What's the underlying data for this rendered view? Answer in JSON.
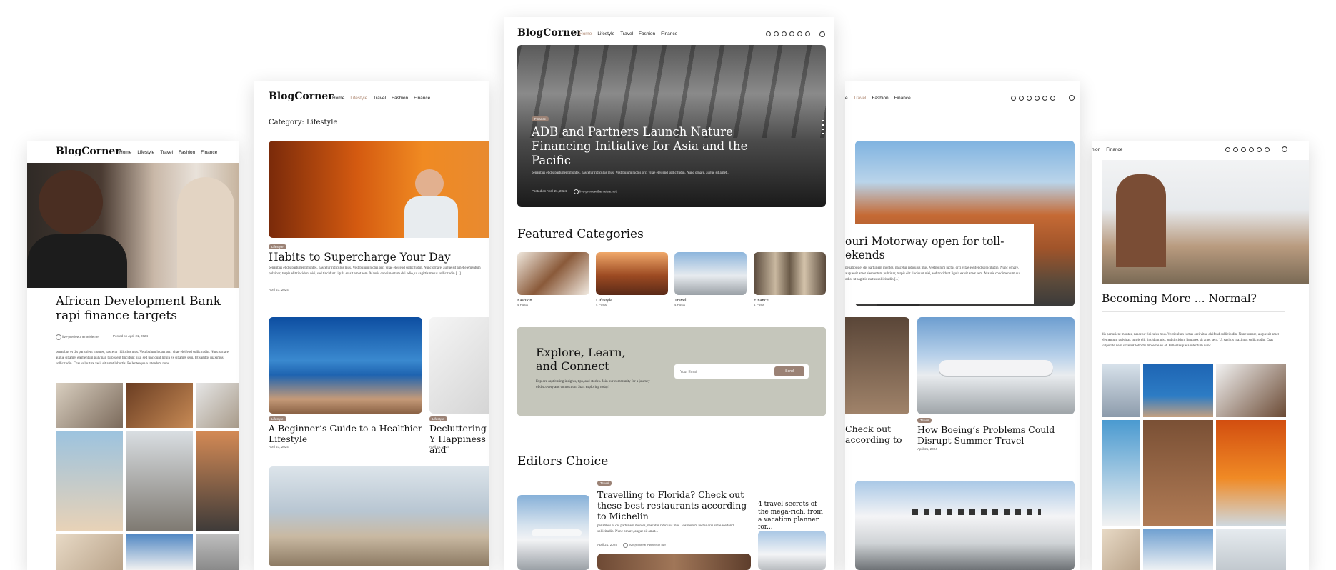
{
  "brand": "BlogCorner",
  "nav": {
    "home": "Home",
    "lifestyle": "Lifestyle",
    "travel": "Travel",
    "fashion": "Fashion",
    "finance": "Finance"
  },
  "social_icons": [
    "facebook-icon",
    "instagram-icon",
    "x-icon",
    "linkedin-icon",
    "tiktok-icon",
    "youtube-icon"
  ],
  "colors": {
    "accent": "#9b8275",
    "newsletter_bg": "#c5c6bb",
    "active_nav": "#b08a74"
  },
  "panel1": {
    "title": "African Development Bank rapi finance targets",
    "author": "live-preview.themeisle.net",
    "date": "Posted on April 21, 2024",
    "excerpt": "penatibus et dis parturient montes, nascetur ridiculus mus. Vestibulum luctus orci vitae eleifend sollicitudin. Nunc ornare, augue sit amet elementum pulvinar, turpis elit tincidunt nisi, sed tincidunt ligula ex sit amet sem. Ut sagittis maximus sollicitudin. Cras vulputate velit sit amet lobortis. Pellentesque a interdum nunc."
  },
  "panel2": {
    "category": "Category: Lifestyle",
    "post1": {
      "tag": "Lifestyle",
      "title": "Habits to Supercharge Your Day",
      "excerpt": "penatibus et dis parturient montes, nascetur ridiculus mus. Vestibulum luctus orci vitae eleifend sollicitudin. Nunc ornare, augue sit amet elementum pulvinar, turpis elit tincidunt nisi, sed tincidunt ligula ex sit amet sem. Mauris condimentum dui odio, ut sagittis metus sollicitudin [...]",
      "date": "April 21, 2024"
    },
    "post2": {
      "tag": "Lifestyle",
      "title": "A Beginner’s Guide to a Healthier Lifestyle",
      "date": "April 21, 2024"
    },
    "post3": {
      "tag": "Lifestyle",
      "title": "Decluttering Y Happiness and",
      "date": "April 21, 2024"
    }
  },
  "panel3": {
    "hero": {
      "tag": "Finance",
      "title": "ADB and Partners Launch Nature Financing Initiative for Asia and the Pacific",
      "excerpt": "penatibus et dis parturient montes, nascetur ridiculus mus. Vestibulum luctus orci vitae eleifend sollicitudin. Nunc ornare, augue sit amet...",
      "date": "Posted on April 21, 2024",
      "author": "live-preview.themeisle.net"
    },
    "featured_heading": "Featured Categories",
    "categories": [
      {
        "name": "Fashion",
        "count": "4 Posts"
      },
      {
        "name": "Lifestyle",
        "count": "4 Posts"
      },
      {
        "name": "Travel",
        "count": "4 Posts"
      },
      {
        "name": "Finance",
        "count": "4 Posts"
      }
    ],
    "newsletter": {
      "title": "Explore, Learn, and Connect",
      "text": "Explore captivating insights, tips, and stories. Join our community for a journey of discovery and connection. Start exploring today!",
      "placeholder": "Your Email",
      "button": "Send"
    },
    "editors_heading": "Editors Choice",
    "editor_post": {
      "tag": "Travel",
      "title": "Travelling to Florida? Check out these best restaurants according to Michelin",
      "excerpt": "penatibus et dis parturient montes, nascetur ridiculus mus. Vestibulum luctus orci vitae eleifend sollicitudin. Nunc ornare, augue sit amet...",
      "date": "April 21, 2024",
      "author": "live-preview.themeisle.net"
    },
    "side_post": "4 travel secrets of the mega-rich, from a vacation planner for..."
  },
  "panel4": {
    "title": "ouri Motorway open for toll- ekends",
    "excerpt": "penatibus et dis parturient montes, nascetur ridiculus mus. Vestibulum luctus orci vitae eleifend sollicitudin. Nunc ornare, augue sit amet elementum pulvinar, turpis elit tincidunt nisi, sed tincidunt ligula ex sit amet sem. Mauris condimentum dui odio, ut sagittis metus sollicitudin [...]",
    "left_title": "Check out according to",
    "right_tag": "Travel",
    "right_title": "How Boeing’s Problems Could Disrupt Summer Travel",
    "right_date": "April 21, 2024"
  },
  "panel5": {
    "title": "Becoming More ... Normal?",
    "excerpt": "dis parturient montes, nascetur ridiculus mus. Vestibulum luctus orci vitae eleifend sollicitudin. Nunc ornare, augue sit amet elementum pulvinar, turpis elit tincidunt nisi, sed tincidunt ligula ex sit amet sem. Ut sagittis maximus sollicitudin. Cras vulputate velit sit amet lobortis molestie ex et. Pellentesque a interdum nunc."
  }
}
